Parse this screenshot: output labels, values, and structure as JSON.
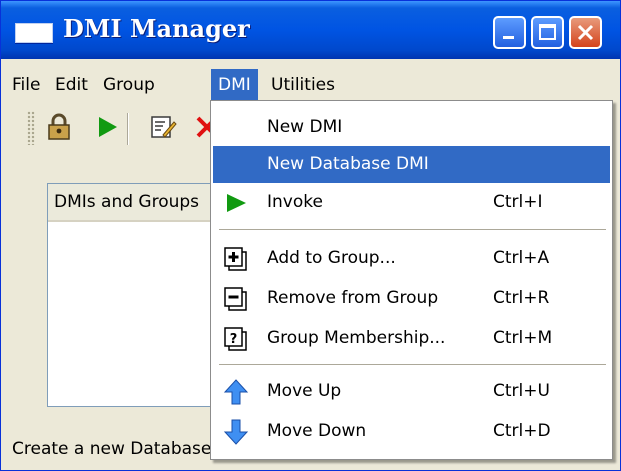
{
  "window": {
    "title": "DMI Manager"
  },
  "menubar": {
    "items": [
      "File",
      "Edit",
      "Group",
      "DMI",
      "Utilities"
    ],
    "active": "DMI"
  },
  "toolbar": {
    "icons": [
      "lock-icon",
      "play-icon",
      "edit-icon",
      "delete-icon"
    ]
  },
  "list": {
    "header": "DMIs and Groups"
  },
  "status": {
    "text": "Create a new Database DMI"
  },
  "dmi_menu": {
    "items": [
      {
        "label": "New DMI",
        "shortcut": "",
        "icon": ""
      },
      {
        "label": "New Database DMI",
        "shortcut": "",
        "icon": "",
        "highlighted": true
      },
      {
        "label": "Invoke",
        "shortcut": "Ctrl+I",
        "icon": "play-icon"
      },
      {
        "label": "Add to Group...",
        "shortcut": "Ctrl+A",
        "icon": "add-to-group-icon"
      },
      {
        "label": "Remove from Group",
        "shortcut": "Ctrl+R",
        "icon": "remove-from-group-icon"
      },
      {
        "label": "Group Membership...",
        "shortcut": "Ctrl+M",
        "icon": "group-membership-icon"
      },
      {
        "label": "Move Up",
        "shortcut": "Ctrl+U",
        "icon": "arrow-up-icon"
      },
      {
        "label": "Move Down",
        "shortcut": "Ctrl+D",
        "icon": "arrow-down-icon"
      }
    ]
  },
  "colors": {
    "titlebar": "#0054e3",
    "menu_highlight": "#316ac5",
    "invoke_green": "#119a11",
    "close_red": "#d4431c"
  }
}
